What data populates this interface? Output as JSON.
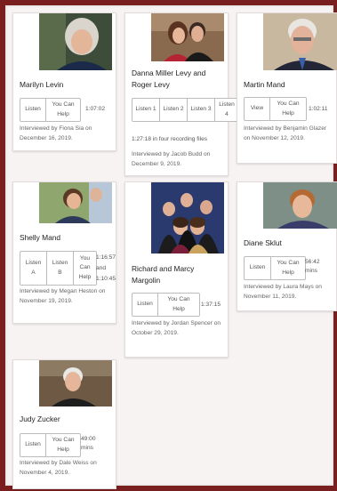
{
  "cards": [
    {
      "name": "Marilyn Levin",
      "buttons": [
        "Listen",
        "You Can Help"
      ],
      "duration": "1:07:02",
      "interviewer": "Interviewed by Fiona Sia on December 16, 2019."
    },
    {
      "name": "Danna Miller Levy and Roger Levy",
      "buttons": [
        "Listen 1",
        "Listen 2",
        "Listen 3",
        "Listen 4"
      ],
      "duration": "1:27:18 in four recording files",
      "interviewer": "Interviewed by Jacob Budd on December 9, 2019."
    },
    {
      "name": "Martin Mand",
      "buttons": [
        "View",
        "You Can Help"
      ],
      "duration": "1:02:11",
      "interviewer": "Interviewed by Benjamin Glazer on November 12, 2019."
    },
    {
      "name": "Shelly Mand",
      "buttons": [
        "Listen A",
        "Listen B",
        "You Can Help"
      ],
      "duration": "1:16:57 and 1:10:45",
      "interviewer": "Interviewed by Megan Heston on November 19, 2019."
    },
    {
      "name": "Richard and Marcy Margolin",
      "buttons": [
        "Listen",
        "You Can Help"
      ],
      "duration": "1:37:15",
      "interviewer": "Interviewed by Jordan Spencer on October 29, 2019."
    },
    {
      "name": "Diane Sklut",
      "buttons": [
        "Listen",
        "You Can Help"
      ],
      "duration": "56:42 mins",
      "interviewer": "Interviewed by Laura Mays on November 11, 2019."
    },
    {
      "name": "Judy Zucker",
      "buttons": [
        "Listen",
        "You Can Help"
      ],
      "duration": "49:00 mins",
      "interviewer": "Interviewed by Dale Weiss on November 4, 2019."
    }
  ]
}
